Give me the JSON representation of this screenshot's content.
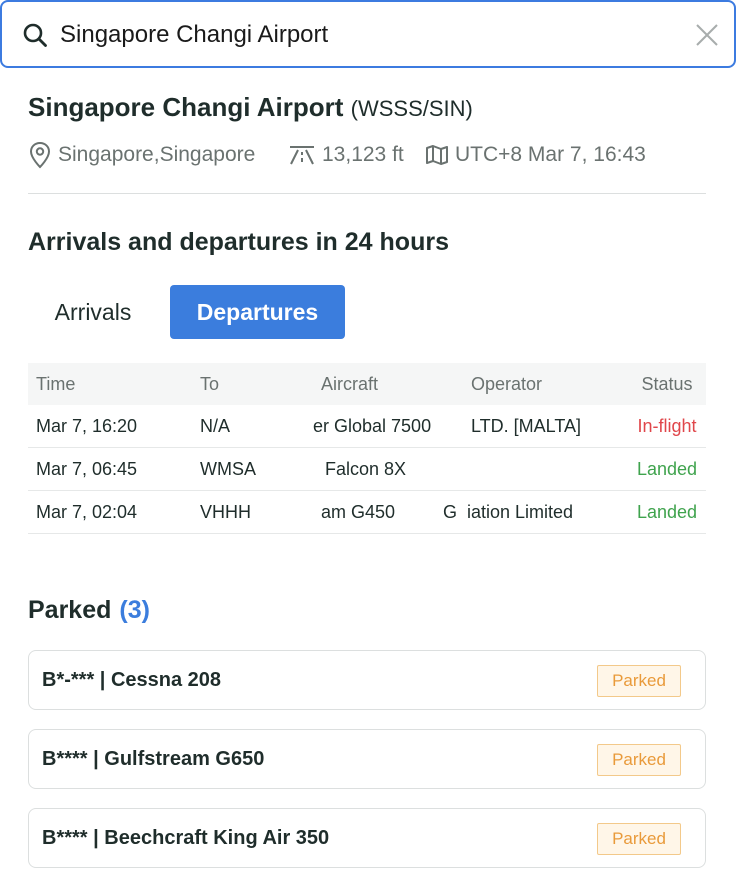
{
  "search": {
    "value": "Singapore Changi Airport",
    "icon": "search-icon",
    "clear_icon": "close-icon"
  },
  "airport": {
    "name": "Singapore Changi Airport",
    "codes": "(WSSS/SIN)",
    "location": "Singapore,Singapore",
    "elevation": "13,123 ft",
    "local_time": "UTC+8 Mar 7, 16:43"
  },
  "schedule": {
    "heading": "Arrivals and departures in 24 hours",
    "tabs": [
      {
        "label": "Arrivals",
        "active": false
      },
      {
        "label": "Departures",
        "active": true
      }
    ],
    "columns": [
      "Time",
      "To",
      "Aircraft",
      "Operator",
      "Status"
    ],
    "rows": [
      {
        "time": "Mar 7, 16:20",
        "to": "N/A",
        "aircraft": "er Global 7500",
        "operator": "LTD. [MALTA]",
        "status": "In-flight"
      },
      {
        "time": "Mar 7, 06:45",
        "to": "WMSA",
        "aircraft": "Falcon 8X",
        "operator": "",
        "status": "Landed"
      },
      {
        "time": "Mar 7, 02:04",
        "to": "VHHH",
        "aircraft": "am G450",
        "operator": "G  iation Limited",
        "status": "Landed"
      }
    ]
  },
  "parked": {
    "heading": "Parked",
    "count": "(3)",
    "items": [
      {
        "label": "B*-*** | Cessna 208",
        "badge": "Parked"
      },
      {
        "label": "B**** | Gulfstream G650",
        "badge": "Parked"
      },
      {
        "label": "B**** | Beechcraft King Air 350",
        "badge": "Parked"
      }
    ]
  },
  "colors": {
    "accent": "#3b7ddd",
    "inflight": "#e0464a",
    "landed": "#3fa34d",
    "badge_text": "#e99a3a",
    "badge_bg": "#fff6e8"
  }
}
